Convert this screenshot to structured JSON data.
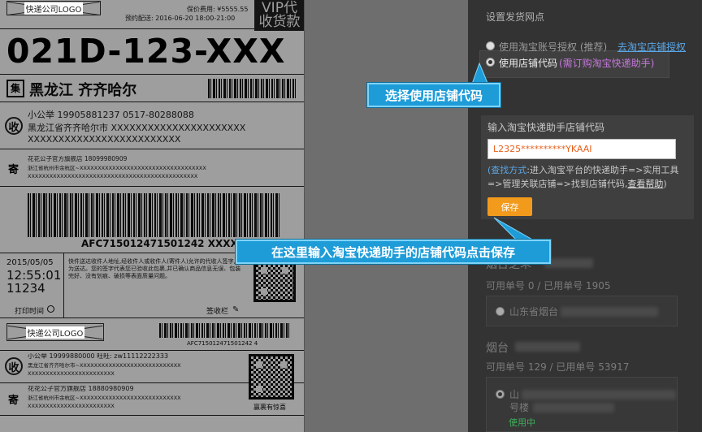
{
  "label": {
    "logo_text": "快递公司LOGO",
    "price_line": "保价费用: ¥5555.55",
    "delivery_line": "预约配送: 2016-06-20 18:00-21:00",
    "vip_line1": "VIP代",
    "vip_line2": "收货款",
    "big_code": "021D-123-XXX",
    "route_badge": "集",
    "route_text": "黑龙江 齐齐哈尔",
    "recv_badge": "收",
    "recv_name_phone": "小公举    19905881237    0517-80288088",
    "recv_addr1": "黑龙江省齐齐哈尔市 XXXXXXXXXXXXXXXXXXXXXX",
    "recv_addr2": "XXXXXXXXXXXXXXXXXXXXXXXXX",
    "send_badge": "寄",
    "send_name_phone": "花花公子官方旗舰店    18099980909",
    "send_addr1": "浙江省杭州市余杭区~XXXXXXXXXXXXXXXXXXXXXXXXXXXXXXXXXXX",
    "send_addr2": "XXXXXXXXXXXXXXXXXXXXXXXXXXXXXXXXXXXXXXXXXXXXXXX",
    "barcode_number": "AFC715012471501242 XXXX",
    "print_date": "2015/05/05",
    "print_time": "12:55:01",
    "print_code": "11234",
    "print_time_label": "打印时间",
    "notice": "快件送达收件人地址,经收件人或收件人(寄件人)允许的代收人签字,视为送达。您的签字代表您已验收此包裹,并已确认商品信息无误、包装完好、没有划痕、破损等表面质量问题。",
    "sign_label": "签收栏",
    "stub_logo": "快递公司LOGO",
    "stub_barcode_number": "AFC715012471501242 4",
    "stub_recv": "小公举    19999880000    旺旺: zw11112222333",
    "stub_recv_addr1": "黑龙江省齐齐哈尔市~XXXXXXXXXXXXXXXXXXXXXXXXXXXX",
    "stub_recv_addr2": "XXXXXXXXXXXXXXXXXXXXXXXX",
    "stub_send": "花花公子官方旗舰店    18880980909",
    "stub_send_addr1": "浙江省杭州市余杭区~XXXXXXXXXXXXXXXXXXXXXXXXXXXX",
    "stub_send_addr2": "XXXXXXXXXXXXXXXXXXXXXXXX",
    "stub_qr_caption": "赢裹有惊喜"
  },
  "settings": {
    "title": "设置发货网点",
    "option1_label": "使用淘宝账号授权 (推荐)",
    "option1_link": "去淘宝店铺授权",
    "option2_label": "使用店铺代码",
    "option2_note": "(需订购淘宝快递助手)",
    "input_label": "输入淘宝快递助手店铺代码",
    "input_value": "L2325**********YKAAI",
    "hint_how": "(查找方式",
    "hint_body": ":进入淘宝平台的快递助手=>实用工具=>管理关联店铺=>找到店铺代码,",
    "hint_link": "查看帮助",
    "hint_end": ")",
    "save_label": "保存",
    "site1_name": "烟台芝罘",
    "site1_usage": "可用单号 0 / 已用单号 1905",
    "site1_option": "山东省烟台",
    "site2_name": "烟台",
    "site2_usage": "可用单号 129 / 已用单号 53917",
    "site2_option": "山",
    "site2_sub": "号楼",
    "site2_status": "使用中"
  },
  "callouts": {
    "select_text": "选择使用店铺代码",
    "input_text": "在这里输入淘宝快递助手的店铺代码点击保存"
  },
  "colors": {
    "callout": "#1d9cd8",
    "save": "#f29a1c",
    "in_use": "#3fae5a",
    "option_note": "#c678dd",
    "input_text": "#e8601c"
  }
}
